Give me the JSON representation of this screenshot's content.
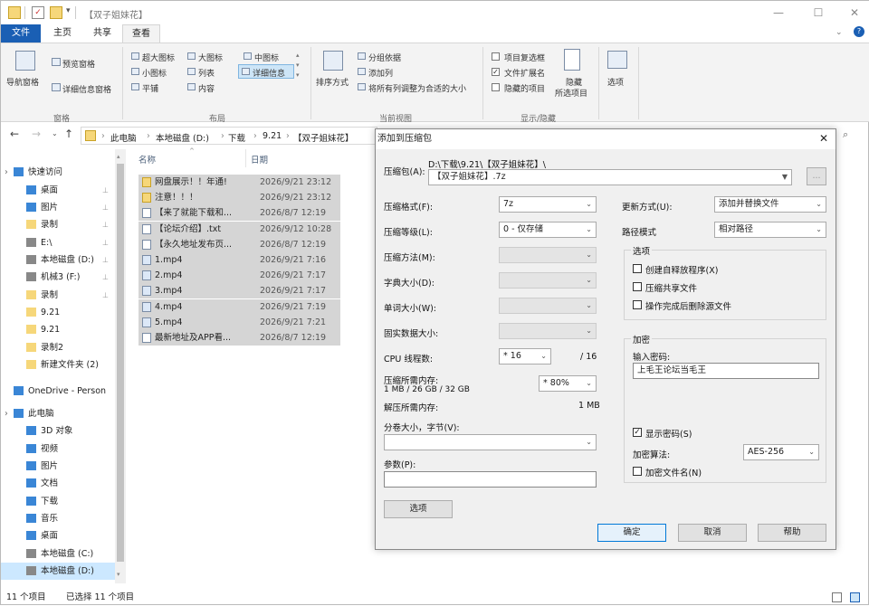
{
  "window": {
    "title": "【双子姐妹花】"
  },
  "ribbon_tabs": [
    "文件",
    "主页",
    "共享",
    "查看"
  ],
  "ribbon": {
    "panes": {
      "nav_pane": "导航窗格",
      "preview_pane": "预览窗格",
      "details_pane": "详细信息窗格",
      "group": "窗格"
    },
    "layout": {
      "xl_icons": "超大图标",
      "large_icons": "大图标",
      "medium_icons": "中图标",
      "small_icons": "小图标",
      "list": "列表",
      "details": "详细信息",
      "tiles": "平铺",
      "content": "内容",
      "group": "布局"
    },
    "current_view": {
      "sort_by": "排序方式",
      "group_by": "分组依据",
      "add_columns": "添加列",
      "size_all": "将所有列调整为合适的大小",
      "group": "当前视图"
    },
    "show_hide": {
      "item_checkboxes": "项目复选框",
      "file_extensions": "文件扩展名",
      "hidden_items": "隐藏的项目",
      "hide_selected": "隐藏",
      "hide_selected2": "所选项目",
      "group": "显示/隐藏"
    },
    "options": "选项"
  },
  "address": {
    "crumbs": [
      "此电脑",
      "本地磁盘 (D:)",
      "下载",
      "9.21",
      "【双子姐妹花】"
    ]
  },
  "nav": {
    "items": [
      {
        "label": "快速访问",
        "pin": false
      },
      {
        "label": "桌面",
        "pin": true
      },
      {
        "label": "图片",
        "pin": true
      },
      {
        "label": "录制",
        "pin": true
      },
      {
        "label": "E:\\",
        "pin": true
      },
      {
        "label": "本地磁盘 (D:)",
        "pin": true
      },
      {
        "label": "机械3 (F:)",
        "pin": true
      },
      {
        "label": "录制",
        "pin": true
      },
      {
        "label": "9.21",
        "pin": false
      },
      {
        "label": "9.21",
        "pin": false
      },
      {
        "label": "录制2",
        "pin": false
      },
      {
        "label": "新建文件夹 (2)",
        "pin": false
      },
      {
        "label": "OneDrive - Person",
        "pin": false
      },
      {
        "label": "此电脑",
        "pin": false
      },
      {
        "label": "3D 对象",
        "pin": false
      },
      {
        "label": "视频",
        "pin": false
      },
      {
        "label": "图片",
        "pin": false
      },
      {
        "label": "文档",
        "pin": false
      },
      {
        "label": "下载",
        "pin": false
      },
      {
        "label": "音乐",
        "pin": false
      },
      {
        "label": "桌面",
        "pin": false
      },
      {
        "label": "本地磁盘 (C:)",
        "pin": false
      },
      {
        "label": "本地磁盘 (D:)",
        "pin": false
      }
    ]
  },
  "list": {
    "col_name": "名称",
    "col_date": "日期",
    "rows": [
      {
        "name": "网盘展示！！年通!",
        "date": "2026/9/21 23:12"
      },
      {
        "name": "注意！！！",
        "date": "2026/9/21 23:12"
      },
      {
        "name": "【来了就能下载和...",
        "date": "2026/8/7 12:19"
      },
      {
        "name": "【论坛介绍】.txt",
        "date": "2026/9/12 10:28"
      },
      {
        "name": "【永久地址发布页...",
        "date": "2026/8/7 12:19"
      },
      {
        "name": "1.mp4",
        "date": "2026/9/21 7:16"
      },
      {
        "name": "2.mp4",
        "date": "2026/9/21 7:17"
      },
      {
        "name": "3.mp4",
        "date": "2026/9/21 7:17"
      },
      {
        "name": "4.mp4",
        "date": "2026/9/21 7:19"
      },
      {
        "name": "5.mp4",
        "date": "2026/9/21 7:21"
      },
      {
        "name": "最新地址及APP看...",
        "date": "2026/8/7 12:19"
      }
    ]
  },
  "status": {
    "count": "11 个项目",
    "selected": "已选择 11 个项目"
  },
  "dialog": {
    "title": "添加到压缩包",
    "archive_label": "压缩包(A):",
    "archive_path": "D:\\下载\\9.21\\【双子姐妹花】\\",
    "archive_name": "【双子姐妹花】.7z",
    "browse": "...",
    "format_label": "压缩格式(F):",
    "format_value": "7z",
    "level_label": "压缩等级(L):",
    "level_value": "0 - 仅存储",
    "method_label": "压缩方法(M):",
    "dict_label": "字典大小(D):",
    "word_label": "单词大小(W):",
    "solid_label": "固实数据大小:",
    "threads_label": "CPU 线程数:",
    "threads_value": "* 16",
    "threads_max": "/ 16",
    "mem_c_label": "压缩所需内存:",
    "mem_c_info": "1 MB / 26 GB / 32 GB",
    "mem_c_value": "* 80%",
    "mem_d_label": "解压所需内存:",
    "mem_d_value": "1 MB",
    "split_label": "分卷大小，字节(V):",
    "params_label": "参数(P):",
    "options_btn": "选项",
    "update_label": "更新方式(U):",
    "update_value": "添加并替换文件",
    "pathmode_label": "路径模式",
    "pathmode_value": "相对路径",
    "opts_group": "选项",
    "opt_sfx": "创建自释放程序(X)",
    "opt_shared": "压缩共享文件",
    "opt_delete": "操作完成后删除源文件",
    "enc_group": "加密",
    "pwd_label": "输入密码:",
    "pwd_value": "上毛王论坛当毛王",
    "show_pwd": "显示密码(S)",
    "enc_method_label": "加密算法:",
    "enc_method_value": "AES-256",
    "enc_names": "加密文件名(N)",
    "ok": "确定",
    "cancel": "取消",
    "help": "帮助"
  }
}
